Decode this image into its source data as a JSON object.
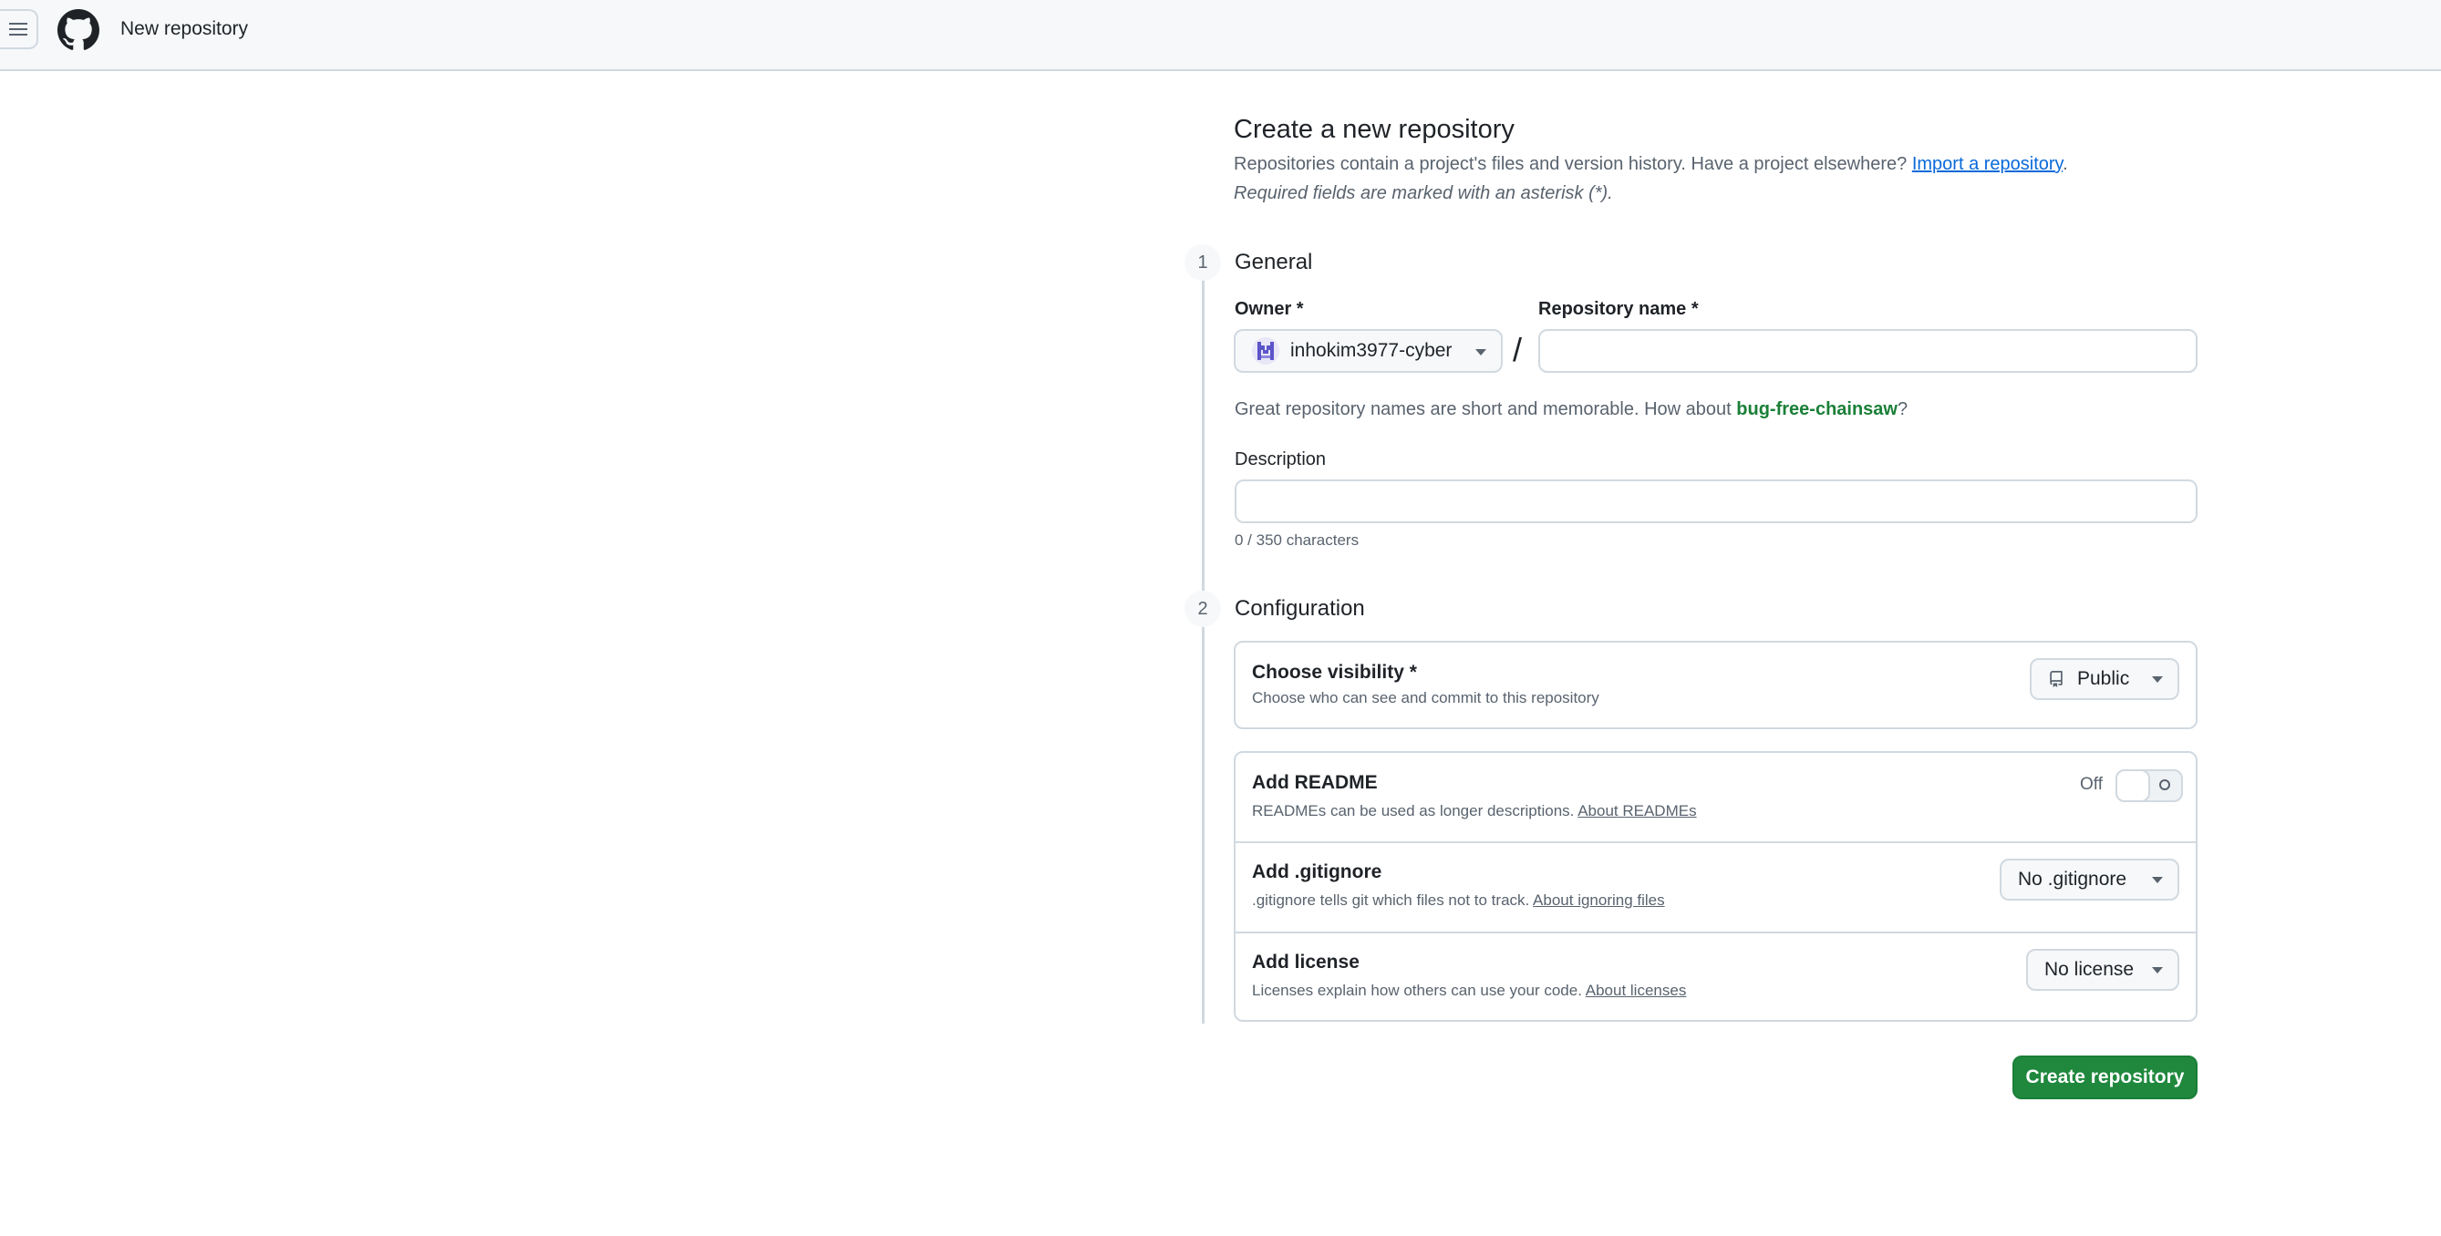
{
  "header": {
    "title": "New repository",
    "menu_icon": "hamburger-icon",
    "logo_icon": "github-logo-icon"
  },
  "intro": {
    "title": "Create a new repository",
    "description": "Repositories contain a project's files and version history. Have a project elsewhere?",
    "import_link": "Import a repository",
    "period": ".",
    "required_note": "Required fields are marked with an asterisk (*)."
  },
  "general": {
    "step": "1",
    "title": "General",
    "owner_label": "Owner *",
    "owner_value": "inhokim3977-cyber",
    "slash": "/",
    "repo_name_label": "Repository name *",
    "repo_name_value": "",
    "hint_prefix": "Great repository names are short and memorable. How about",
    "hint_suggestion": "bug-free-chainsaw",
    "hint_suffix": "?",
    "description_label": "Description",
    "description_value": "",
    "char_count": "0 / 350 characters"
  },
  "configuration": {
    "step": "2",
    "title": "Configuration",
    "visibility": {
      "title": "Choose visibility *",
      "description": "Choose who can see and commit to this repository",
      "value": "Public",
      "icon": "repo-icon"
    },
    "readme": {
      "title": "Add README",
      "description": "READMEs can be used as longer descriptions.",
      "link": "About READMEs",
      "toggle_label": "Off",
      "enabled": false
    },
    "gitignore": {
      "title": "Add .gitignore",
      "description": ".gitignore tells git which files not to track.",
      "link": "About ignoring files",
      "value": "No .gitignore"
    },
    "license": {
      "title": "Add license",
      "description": "Licenses explain how others can use your code.",
      "link": "About licenses",
      "value": "No license"
    }
  },
  "actions": {
    "create_label": "Create repository"
  },
  "colors": {
    "accent_green": "#1f883d",
    "suggestion_green": "#1a7f37",
    "link_blue": "#0969da",
    "border": "#d1d9e0",
    "muted_text": "#59636e"
  }
}
